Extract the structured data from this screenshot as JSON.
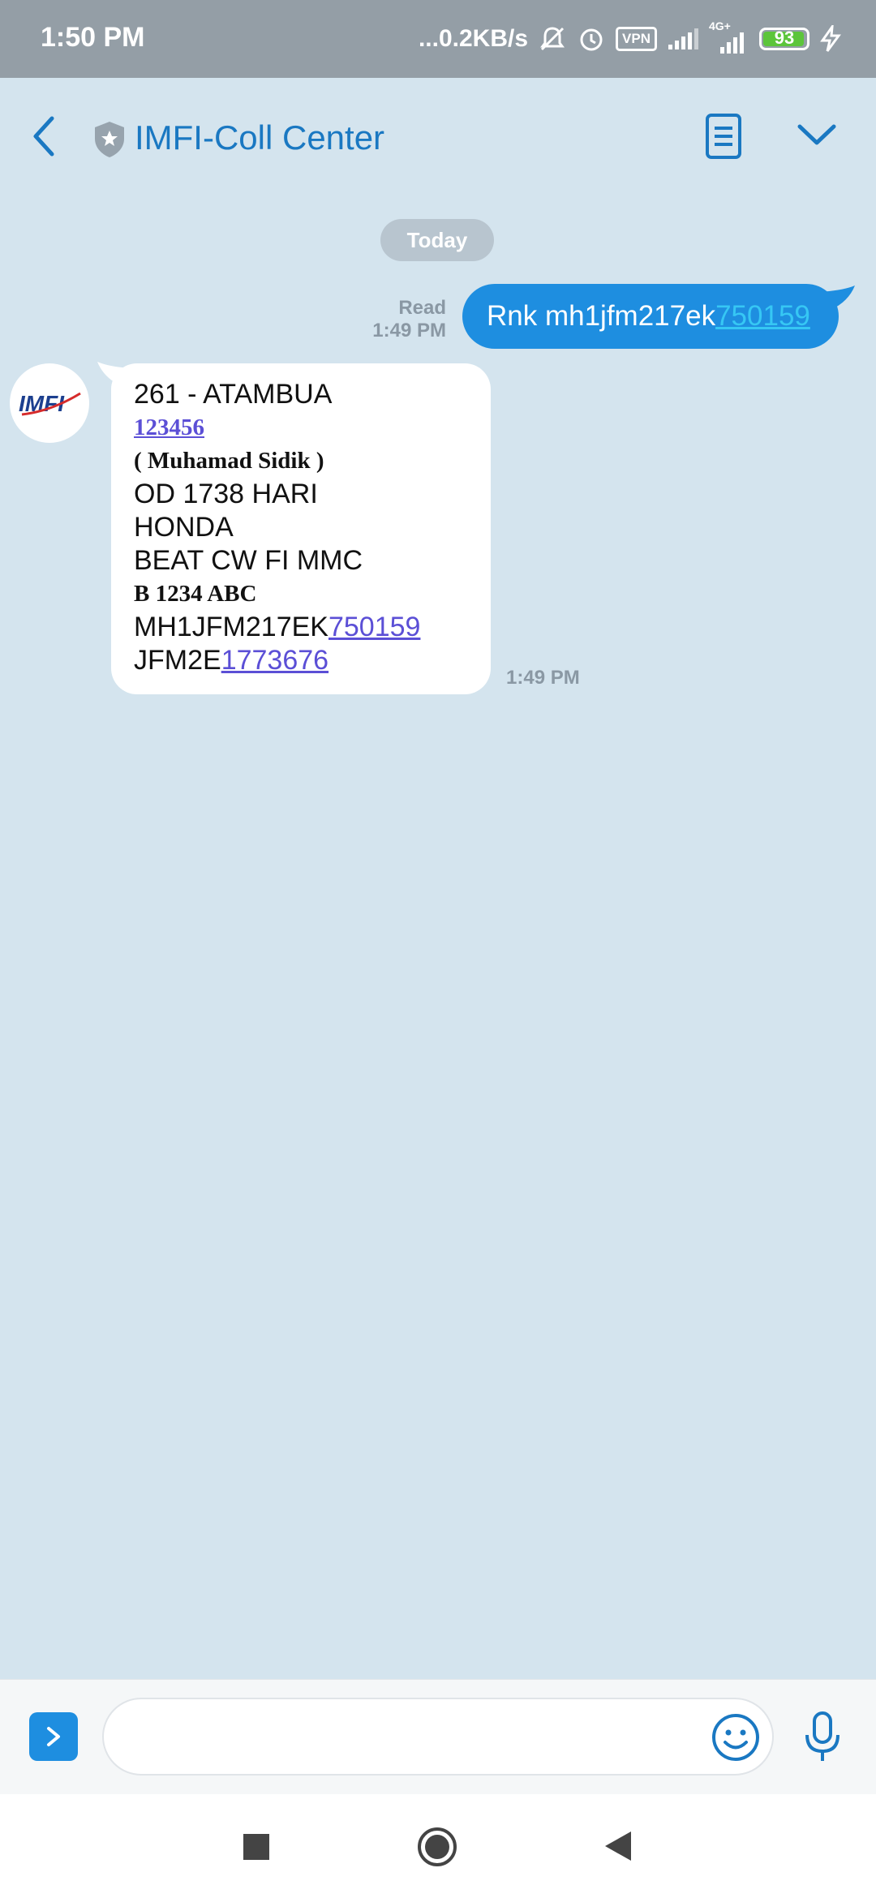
{
  "status_bar": {
    "time": "1:50 PM",
    "net_speed": "...0.2KB/s",
    "vpn": "VPN",
    "network_type": "4G+",
    "battery_level": "93",
    "battery_color": "#5cc53b"
  },
  "header": {
    "title": "IMFI-Coll Center",
    "accent_color": "#1a78c2",
    "icons": [
      "back-arrow-icon",
      "verified-shield-icon",
      "document-icon",
      "chevron-down-icon"
    ]
  },
  "conversation": {
    "date_chip": "Today",
    "outgoing": {
      "status": "Read",
      "time": "1:49 PM",
      "text_prefix": "Rnk mh1jfm217ek",
      "text_link": "750159",
      "bubble_color": "#1e8ee0"
    },
    "incoming": {
      "avatar_label": "IMFI",
      "time": "1:49 PM",
      "lines": {
        "l1": "261 - ATAMBUA",
        "l2": "123456",
        "l3": "( Muhamad Sidik )",
        "l4": "OD 1738 HARI",
        "l5": "HONDA",
        "l6": "BEAT CW FI MMC",
        "l7": "B 1234 ABC",
        "l8_prefix": "MH1JFM217EK",
        "l8_link": "750159",
        "l9_prefix": "JFM2E",
        "l9_link": "1773676"
      }
    }
  },
  "composer": {
    "placeholder": "",
    "icons": [
      "expand-icon",
      "emoji-icon",
      "microphone-icon"
    ]
  },
  "nav_bar": {
    "icons": [
      "recents-icon",
      "home-icon",
      "back-icon"
    ]
  }
}
